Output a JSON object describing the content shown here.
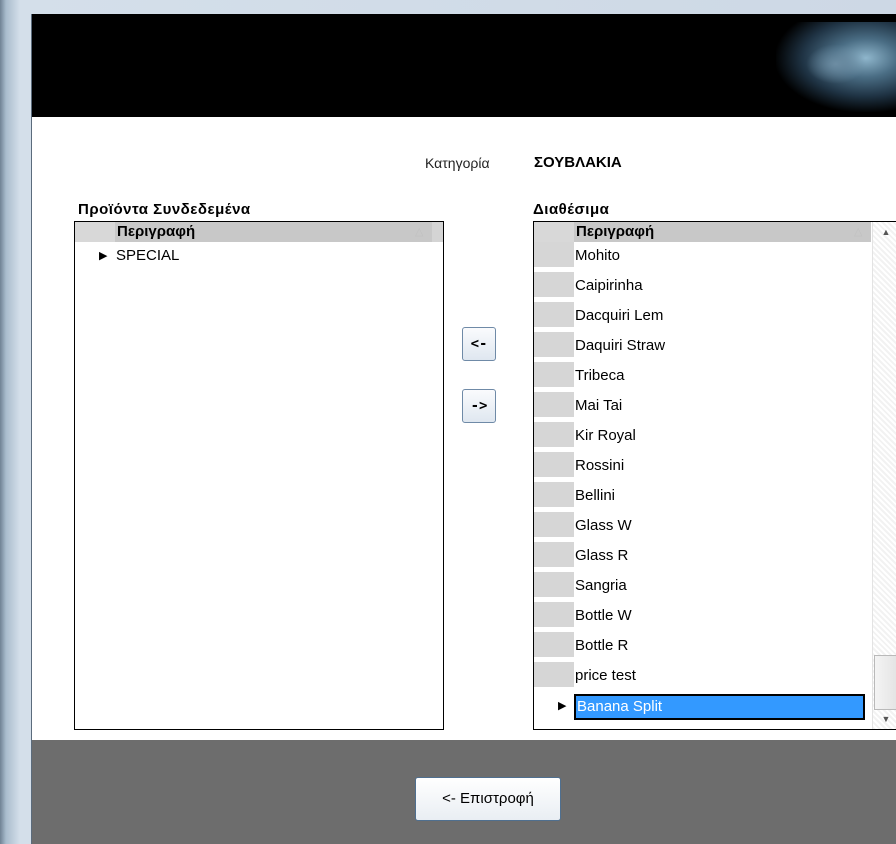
{
  "category": {
    "label": "Κατηγορία",
    "value": "ΣΟΥΒΛΑΚΙΑ"
  },
  "linked_products": {
    "title": "Προϊόντα  Συνδεδεμένα",
    "column_header": "Περιγραφή",
    "sort_glyph": "△",
    "current_marker": "▶",
    "rows": [
      "SPECIAL"
    ]
  },
  "available": {
    "title": "Διαθέσιμα",
    "column_header": "Περιγραφή",
    "sort_glyph": "△",
    "current_marker": "▶",
    "rows": [
      "Mohito",
      "Caipirinha",
      "Dacquiri Lem",
      "Daquiri Straw",
      "Tribeca",
      "Mai Tai",
      "Kir Royal",
      "Rossini",
      "Bellini",
      "Glass W",
      "Glass R",
      "Sangria",
      "Bottle W",
      "Bottle R",
      "price test",
      "Banana Split"
    ],
    "selected_index": 15,
    "scroll_up_glyph": "▲",
    "scroll_down_glyph": "▼"
  },
  "buttons": {
    "add_label": "<-",
    "remove_label": "->",
    "return_label": "<- Επιστροφή"
  },
  "colors": {
    "banner": "#000000",
    "footer": "#6d6d6d",
    "selection": "#3399ff"
  }
}
